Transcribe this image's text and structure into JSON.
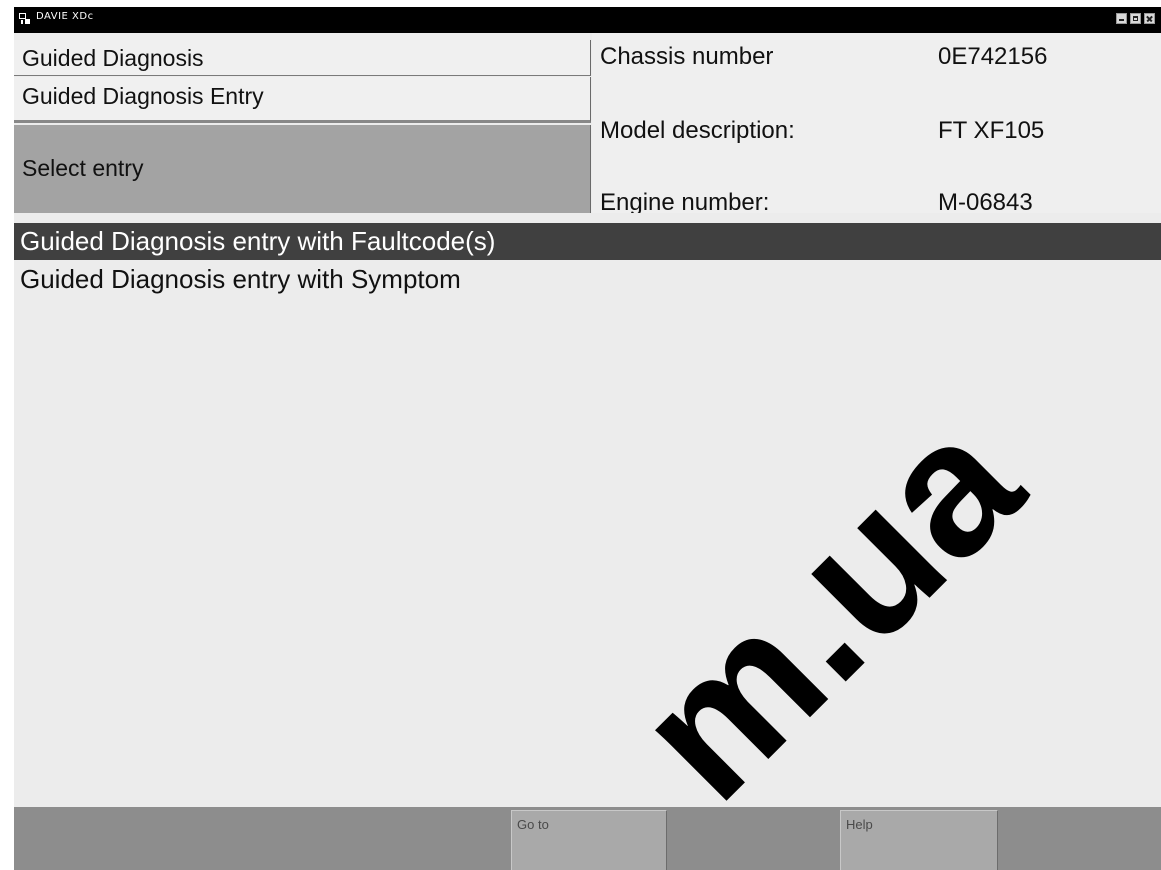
{
  "window": {
    "title": "DAVIE XDc"
  },
  "header": {
    "breadcrumbs": [
      "Guided Diagnosis",
      "Guided Diagnosis Entry"
    ],
    "instruction": "Select entry"
  },
  "vehicle_info": {
    "chassis_label": "Chassis number",
    "chassis_value": "0E742156",
    "model_label": "Model description:",
    "model_value": "FT XF105",
    "engine_label": "Engine number:",
    "engine_value": "M-06843"
  },
  "entries": [
    {
      "label": "Guided Diagnosis entry with Faultcode(s)",
      "selected": true
    },
    {
      "label": "Guided Diagnosis entry with Symptom",
      "selected": false
    }
  ],
  "toolbar": {
    "goto_label": "Go to",
    "help_label": "Help"
  },
  "watermark": "m.ua",
  "colors": {
    "titlebar": "#000000",
    "selection": "#404040",
    "panel": "#a3a3a3",
    "toolbar": "#8d8d8d"
  }
}
